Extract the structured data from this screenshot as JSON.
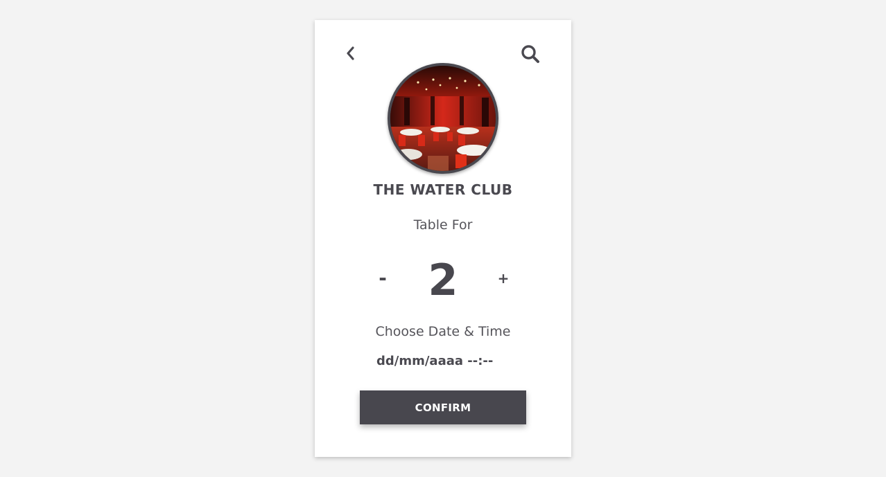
{
  "header": {
    "back_icon": "chevron-left-icon",
    "search_icon": "search-icon"
  },
  "restaurant": {
    "name": "THE WATER CLUB",
    "image_icon": "restaurant-photo"
  },
  "party": {
    "label": "Table For",
    "decrement_label": "-",
    "count": "2",
    "increment_label": "+"
  },
  "datetime": {
    "label": "Choose Date & Time",
    "placeholder": "dd/mm/aaaa --:--"
  },
  "actions": {
    "confirm_label": "CONFIRM"
  },
  "colors": {
    "page_background": "#f3f3f3",
    "card_background": "#ffffff",
    "primary_dark": "#48474e",
    "text": "#4a4950"
  }
}
